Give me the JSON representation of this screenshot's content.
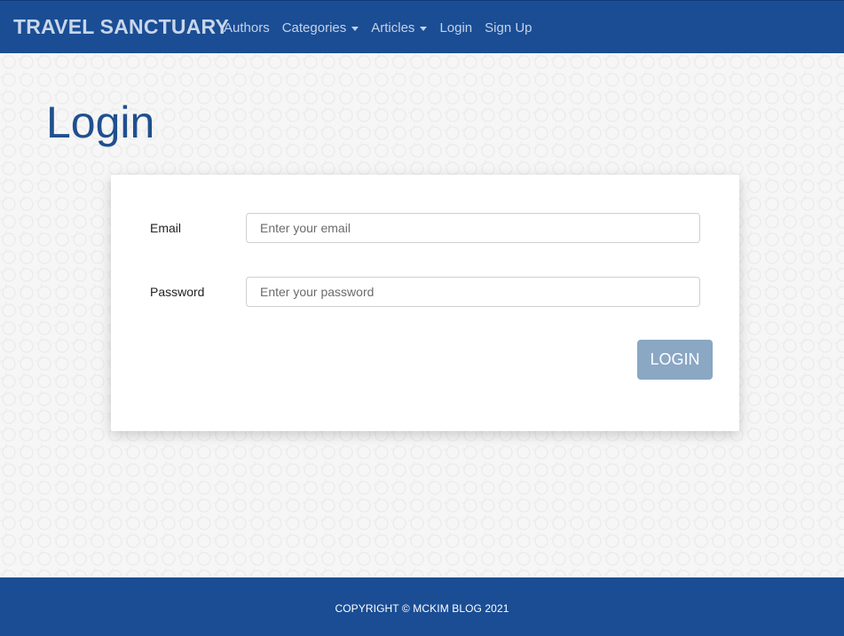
{
  "navbar": {
    "brand": "TRAVEL SANCTUARY",
    "links": [
      {
        "label": "Authors",
        "dropdown": false
      },
      {
        "label": "Categories",
        "dropdown": true
      },
      {
        "label": "Articles",
        "dropdown": true
      },
      {
        "label": "Login",
        "dropdown": false
      },
      {
        "label": "Sign Up",
        "dropdown": false
      }
    ]
  },
  "page": {
    "title": "Login"
  },
  "form": {
    "email_label": "Email",
    "email_placeholder": "Enter your email",
    "email_value": "",
    "password_label": "Password",
    "password_placeholder": "Enter your password",
    "password_value": "",
    "submit_label": "LOGIN"
  },
  "footer": {
    "text": "COPYRIGHT © MCKIM BLOG 2021"
  },
  "colors": {
    "navbar_bg": "#1a4d94",
    "title": "#1f4f8f",
    "button_bg": "#8aa7c4"
  }
}
